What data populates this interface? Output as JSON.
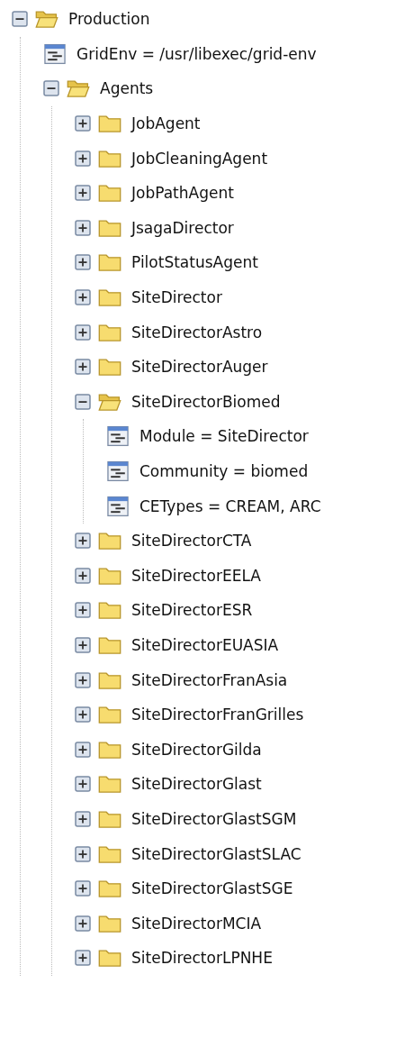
{
  "tree": [
    {
      "kind": "folder",
      "label": "Production",
      "expanded": true,
      "children": [
        {
          "kind": "option",
          "label": "GridEnv = /usr/libexec/grid-env"
        },
        {
          "kind": "folder",
          "label": "Agents",
          "expanded": true,
          "children": [
            {
              "kind": "folder",
              "label": "JobAgent",
              "expanded": false
            },
            {
              "kind": "folder",
              "label": "JobCleaningAgent",
              "expanded": false
            },
            {
              "kind": "folder",
              "label": "JobPathAgent",
              "expanded": false
            },
            {
              "kind": "folder",
              "label": "JsagaDirector",
              "expanded": false
            },
            {
              "kind": "folder",
              "label": "PilotStatusAgent",
              "expanded": false
            },
            {
              "kind": "folder",
              "label": "SiteDirector",
              "expanded": false
            },
            {
              "kind": "folder",
              "label": "SiteDirectorAstro",
              "expanded": false
            },
            {
              "kind": "folder",
              "label": "SiteDirectorAuger",
              "expanded": false
            },
            {
              "kind": "folder",
              "label": "SiteDirectorBiomed",
              "expanded": true,
              "children": [
                {
                  "kind": "option",
                  "label": "Module = SiteDirector"
                },
                {
                  "kind": "option",
                  "label": "Community = biomed"
                },
                {
                  "kind": "option",
                  "label": "CETypes = CREAM, ARC"
                }
              ]
            },
            {
              "kind": "folder",
              "label": "SiteDirectorCTA",
              "expanded": false
            },
            {
              "kind": "folder",
              "label": "SiteDirectorEELA",
              "expanded": false
            },
            {
              "kind": "folder",
              "label": "SiteDirectorESR",
              "expanded": false
            },
            {
              "kind": "folder",
              "label": "SiteDirectorEUASIA",
              "expanded": false
            },
            {
              "kind": "folder",
              "label": "SiteDirectorFranAsia",
              "expanded": false
            },
            {
              "kind": "folder",
              "label": "SiteDirectorFranGrilles",
              "expanded": false
            },
            {
              "kind": "folder",
              "label": "SiteDirectorGilda",
              "expanded": false
            },
            {
              "kind": "folder",
              "label": "SiteDirectorGlast",
              "expanded": false
            },
            {
              "kind": "folder",
              "label": "SiteDirectorGlastSGM",
              "expanded": false
            },
            {
              "kind": "folder",
              "label": "SiteDirectorGlastSLAC",
              "expanded": false
            },
            {
              "kind": "folder",
              "label": "SiteDirectorGlastSGE",
              "expanded": false
            },
            {
              "kind": "folder",
              "label": "SiteDirectorMCIA",
              "expanded": false
            },
            {
              "kind": "folder",
              "label": "SiteDirectorLPNHE",
              "expanded": false
            }
          ]
        }
      ]
    }
  ]
}
